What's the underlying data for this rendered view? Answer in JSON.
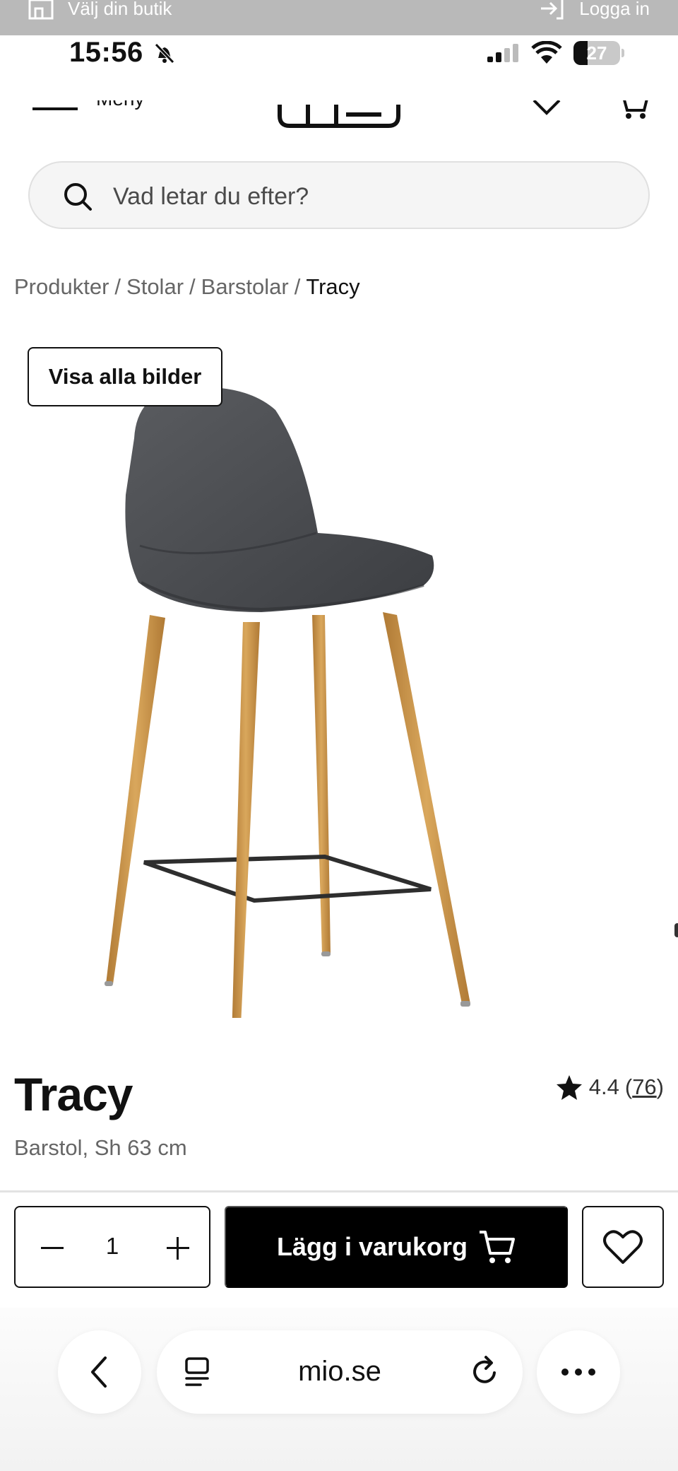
{
  "store_strip": {
    "store_label": "Välj din butik",
    "login_label": "Logga in"
  },
  "status_bar": {
    "time": "15:56",
    "battery": "27"
  },
  "header": {
    "menu_label": "Meny",
    "logo_icon": "mio-logo"
  },
  "search": {
    "placeholder": "Vad letar du efter?"
  },
  "breadcrumb": {
    "items": [
      "Produkter",
      "Stolar",
      "Barstolar"
    ],
    "current": "Tracy",
    "separator": "/"
  },
  "gallery": {
    "show_all_label": "Visa alla bilder"
  },
  "product": {
    "title": "Tracy",
    "subtitle": "Barstol, Sh 63 cm",
    "rating": "4.4",
    "review_count": "76",
    "quantity": "1",
    "add_to_cart_label": "Lägg i varukorg"
  },
  "browser": {
    "url": "mio.se"
  },
  "colors": {
    "primary_button": "#000000",
    "search_bg": "#f5f5f5",
    "muted_text": "#666666",
    "seat_fabric": "#4a4c50",
    "wood_legs": "#c79447"
  }
}
